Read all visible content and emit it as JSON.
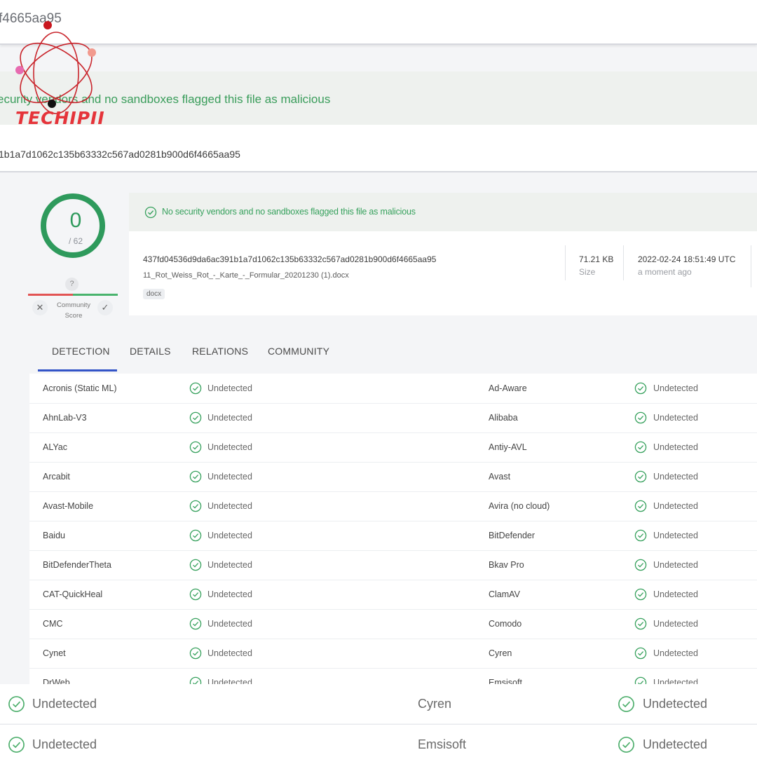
{
  "header": {
    "search_text": "f4665aa95",
    "banner_msg": "ecurity vendors and no sandboxes flagged this file as malicious",
    "hash_fragment": "1b1a7d1062c135b63332c567ad0281b900d6f4665aa95"
  },
  "watermark": {
    "brand": "TECHIPII"
  },
  "score": {
    "detections": "0",
    "total": "/ 62",
    "question_mark": "?",
    "community_label": "Community Score",
    "down_glyph": "✕",
    "up_glyph": "✓"
  },
  "file": {
    "status_msg": "No security vendors and no sandboxes flagged this file as malicious",
    "sha256": "437fd04536d9da6ac391b1a7d1062c135b63332c567ad0281b900d6f4665aa95",
    "name": "11_Rot_Weiss_Rot_-_Karte_-_Formular_20201230 (1).docx",
    "tag": "docx",
    "size_value": "71.21 KB",
    "size_label": "Size",
    "date_value": "2022-02-24 18:51:49 UTC",
    "date_label": "a moment ago"
  },
  "tabs": [
    "DETECTION",
    "DETAILS",
    "RELATIONS",
    "COMMUNITY"
  ],
  "detections": [
    {
      "left": "Acronis (Static ML)",
      "left_result": "Undetected",
      "right": "Ad-Aware",
      "right_result": "Undetected"
    },
    {
      "left": "AhnLab-V3",
      "left_result": "Undetected",
      "right": "Alibaba",
      "right_result": "Undetected"
    },
    {
      "left": "ALYac",
      "left_result": "Undetected",
      "right": "Antiy-AVL",
      "right_result": "Undetected"
    },
    {
      "left": "Arcabit",
      "left_result": "Undetected",
      "right": "Avast",
      "right_result": "Undetected"
    },
    {
      "left": "Avast-Mobile",
      "left_result": "Undetected",
      "right": "Avira (no cloud)",
      "right_result": "Undetected"
    },
    {
      "left": "Baidu",
      "left_result": "Undetected",
      "right": "BitDefender",
      "right_result": "Undetected"
    },
    {
      "left": "BitDefenderTheta",
      "left_result": "Undetected",
      "right": "Bkav Pro",
      "right_result": "Undetected"
    },
    {
      "left": "CAT-QuickHeal",
      "left_result": "Undetected",
      "right": "ClamAV",
      "right_result": "Undetected"
    },
    {
      "left": "CMC",
      "left_result": "Undetected",
      "right": "Comodo",
      "right_result": "Undetected"
    },
    {
      "left": "Cynet",
      "left_result": "Undetected",
      "right": "Cyren",
      "right_result": "Undetected"
    },
    {
      "left": "DrWeb",
      "left_result": "Undetected",
      "right": "Emsisoft",
      "right_result": "Undetected"
    }
  ],
  "bottom_rows": [
    {
      "left_result": "Undetected",
      "vendor": "Cyren",
      "right_result": "Undetected"
    },
    {
      "left_result": "Undetected",
      "vendor": "Emsisoft",
      "right_result": "Undetected"
    }
  ],
  "colors": {
    "ok_green": "#2e9a5c",
    "tab_accent": "#3354c7"
  }
}
